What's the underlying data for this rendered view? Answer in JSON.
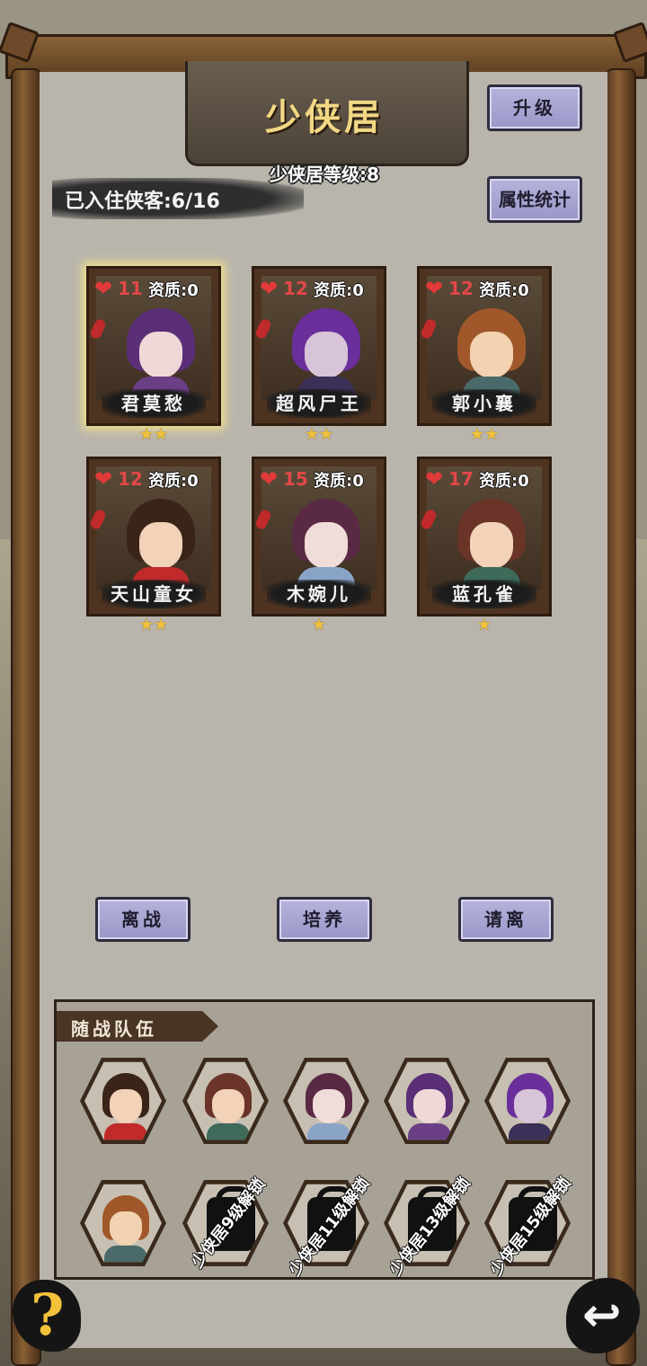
{
  "header": {
    "title": "少侠居",
    "level_text": "少侠居等级:8",
    "residents_text": "已入住侠客:6/16"
  },
  "buttons": {
    "upgrade": "升级",
    "stats": "属性统计",
    "leave_battle": "离战",
    "train": "培养",
    "dismiss": "请离"
  },
  "heroes": [
    {
      "name": "君莫愁",
      "hp": "11",
      "aptitude": "资质:0",
      "stars": "★★",
      "star_count": 2,
      "selected": true
    },
    {
      "name": "超风尸王",
      "hp": "12",
      "aptitude": "资质:0",
      "stars": "★★",
      "star_count": 2,
      "selected": false
    },
    {
      "name": "郭小襄",
      "hp": "12",
      "aptitude": "资质:0",
      "stars": "★★",
      "star_count": 2,
      "selected": false
    },
    {
      "name": "天山童女",
      "hp": "12",
      "aptitude": "资质:0",
      "stars": "★★",
      "star_count": 2,
      "selected": false
    },
    {
      "name": "木婉儿",
      "hp": "15",
      "aptitude": "资质:0",
      "stars": "★",
      "star_count": 1,
      "selected": false
    },
    {
      "name": "蓝孔雀",
      "hp": "17",
      "aptitude": "资质:0",
      "stars": "★",
      "star_count": 1,
      "selected": false
    }
  ],
  "team": {
    "label": "随战队伍",
    "locks": [
      "少侠居9级解锁",
      "少侠居11级解锁",
      "少侠居13级解锁",
      "少侠居15级解锁"
    ]
  },
  "icons": {
    "help": "?",
    "back": "↩",
    "heart": "❤"
  },
  "colors": {
    "button_fill": "#a8a5d4",
    "hp_red": "#e14848",
    "star_gold": "#f2c23a",
    "title_gold": "#f2d884"
  }
}
